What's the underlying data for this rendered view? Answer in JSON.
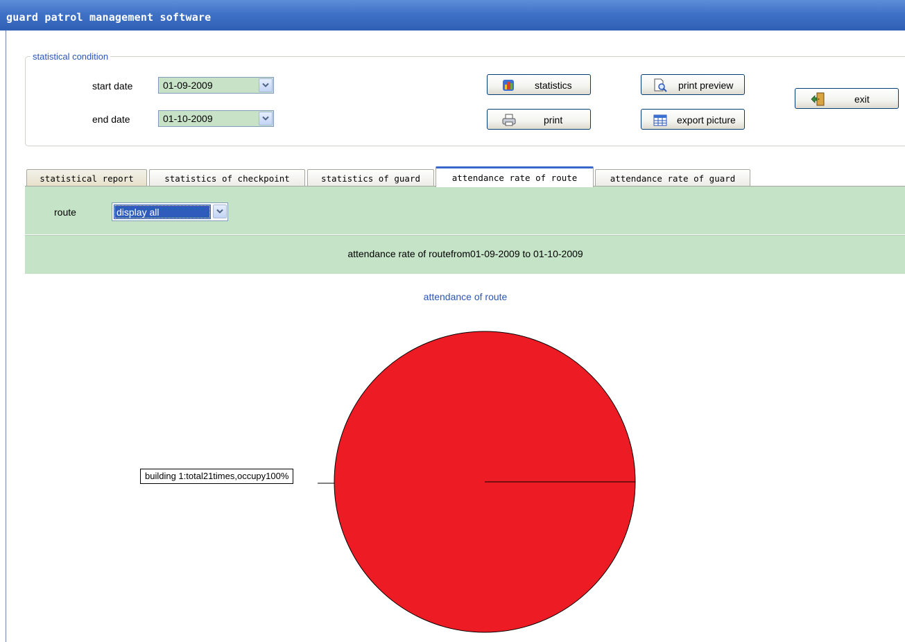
{
  "window": {
    "title": "guard patrol management software"
  },
  "condition": {
    "legend": "statistical condition",
    "start_label": "start date",
    "start_value": "01-09-2009",
    "end_label": "end date",
    "end_value": "01-10-2009"
  },
  "buttons": {
    "statistics": "statistics",
    "print": "print",
    "print_preview": "print preview",
    "export_picture": "export picture",
    "exit": "exit"
  },
  "tabs": [
    {
      "label": "statistical report",
      "active": false
    },
    {
      "label": "statistics of checkpoint",
      "active": false
    },
    {
      "label": "statistics of guard",
      "active": false
    },
    {
      "label": "attendance rate of route",
      "active": true
    },
    {
      "label": "attendance rate of guard",
      "active": false
    }
  ],
  "route": {
    "label": "route",
    "selected": "display all"
  },
  "range_text": "attendance rate of routefrom01-09-2009 to 01-10-2009",
  "colors": {
    "title_bar": "#3f72c6",
    "panel_green": "#c5e3c6",
    "slice": "#ed1c24",
    "accent_text": "#2a55b8"
  },
  "chart_data": {
    "type": "pie",
    "title": "attendance of route",
    "slices": [
      {
        "label": "building 1",
        "count": 21,
        "percent": 100,
        "color": "#ed1c24"
      }
    ],
    "data_labels": [
      "building 1:total21times,occupy100%"
    ],
    "legend": "none"
  }
}
